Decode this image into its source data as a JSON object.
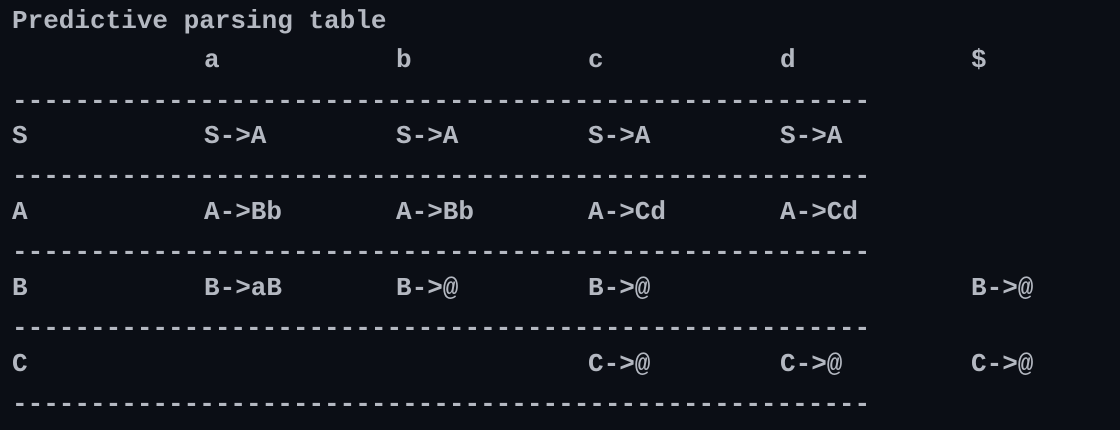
{
  "title": "Predictive parsing table",
  "header": [
    "",
    "a",
    "b",
    "c",
    "d",
    "$"
  ],
  "rows": [
    {
      "nonterminal": "S",
      "cells": [
        "S->A",
        "S->A",
        "S->A",
        "S->A",
        ""
      ]
    },
    {
      "nonterminal": "A",
      "cells": [
        "A->Bb",
        "A->Bb",
        "A->Cd",
        "A->Cd",
        ""
      ]
    },
    {
      "nonterminal": "B",
      "cells": [
        "B->aB",
        "B->@",
        "B->@",
        "",
        "B->@"
      ]
    },
    {
      "nonterminal": "C",
      "cells": [
        "",
        "",
        "C->@",
        "C->@",
        "C->@"
      ]
    }
  ],
  "separator": "-------------------------------------------------------"
}
